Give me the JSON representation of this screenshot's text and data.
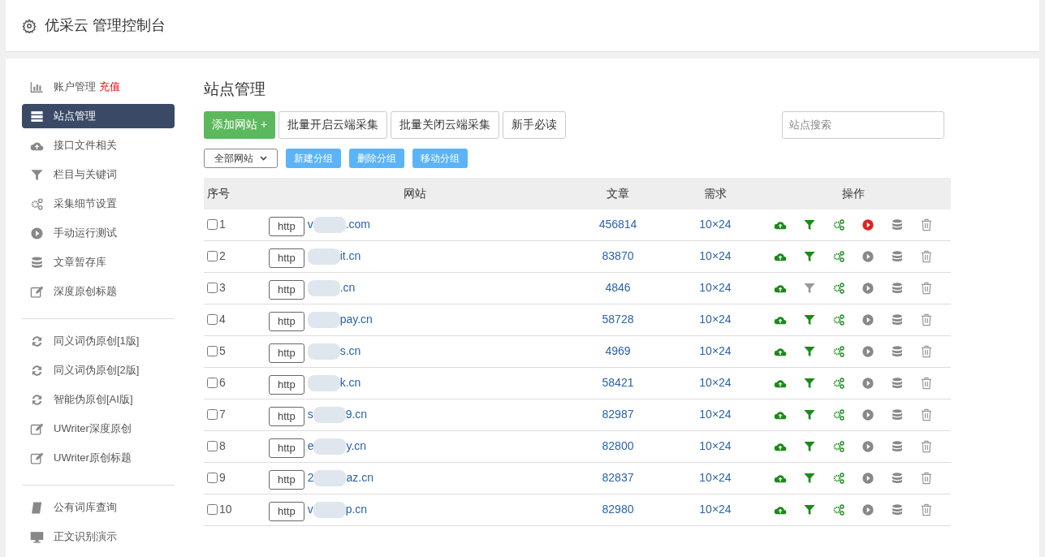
{
  "header": {
    "title": "优采云 管理控制台"
  },
  "sidebar": {
    "groups": [
      [
        {
          "label": "账户管理",
          "badge": "充值",
          "kind": "chart",
          "selected": false
        },
        {
          "label": "站点管理",
          "kind": "list",
          "selected": true
        },
        {
          "label": "接口文件相关",
          "kind": "cloud",
          "selected": false
        },
        {
          "label": "栏目与关键词",
          "kind": "filter",
          "selected": false
        },
        {
          "label": "采集细节设置",
          "kind": "gears",
          "selected": false
        },
        {
          "label": "手动运行测试",
          "kind": "play",
          "selected": false
        },
        {
          "label": "文章暂存库",
          "kind": "db",
          "selected": false
        },
        {
          "label": "深度原创标题",
          "kind": "edit",
          "selected": false
        }
      ],
      [
        {
          "label": "同义词伪原创[1版]",
          "kind": "refresh",
          "selected": false
        },
        {
          "label": "同义词伪原创[2版]",
          "kind": "refresh",
          "selected": false
        },
        {
          "label": "智能伪原创[AI版]",
          "kind": "refresh",
          "selected": false
        },
        {
          "label": "UWriter深度原创",
          "kind": "edit",
          "selected": false
        },
        {
          "label": "UWriter原创标题",
          "kind": "edit",
          "selected": false
        }
      ],
      [
        {
          "label": "公有词库查询",
          "kind": "book",
          "selected": false
        },
        {
          "label": "正文识别演示",
          "kind": "monitor",
          "selected": false
        }
      ]
    ]
  },
  "main": {
    "title": "站点管理",
    "add_button": "添加网站 +",
    "buttons": [
      "批量开启云端采集",
      "批量关闭云端采集",
      "新手必读"
    ],
    "search": {
      "placeholder": "站点搜索"
    },
    "group_select": "全部网站",
    "group_buttons": [
      "新建分组",
      "删除分组",
      "移动分组"
    ],
    "table": {
      "columns": [
        "序号",
        "网站",
        "文章",
        "需求",
        "操作"
      ],
      "rows": [
        {
          "no": "1",
          "checked": false,
          "scheme": "http",
          "prefix": "v",
          "suffix": ".com",
          "articles": "456814",
          "demand": "10×24",
          "filter_on": true,
          "running": true
        },
        {
          "no": "2",
          "checked": false,
          "scheme": "http",
          "suffix": "it.cn",
          "articles": "83870",
          "demand": "10×24",
          "filter_on": true,
          "running": false
        },
        {
          "no": "3",
          "checked": false,
          "scheme": "http",
          "suffix": ".cn",
          "articles": "4846",
          "demand": "10×24",
          "filter_on": false,
          "running": false
        },
        {
          "no": "4",
          "checked": false,
          "scheme": "http",
          "suffix": "pay.cn",
          "articles": "58728",
          "demand": "10×24",
          "filter_on": true,
          "running": false
        },
        {
          "no": "5",
          "checked": false,
          "scheme": "http",
          "suffix": "s.cn",
          "articles": "4969",
          "demand": "10×24",
          "filter_on": true,
          "running": false
        },
        {
          "no": "6",
          "checked": false,
          "scheme": "http",
          "suffix": "k.cn",
          "articles": "58421",
          "demand": "10×24",
          "filter_on": true,
          "running": false
        },
        {
          "no": "7",
          "checked": false,
          "scheme": "http",
          "prefix": "s",
          "suffix": "9.cn",
          "articles": "82987",
          "demand": "10×24",
          "filter_on": true,
          "running": false
        },
        {
          "no": "8",
          "checked": false,
          "scheme": "http",
          "prefix": "e",
          "suffix": "y.cn",
          "articles": "82800",
          "demand": "10×24",
          "filter_on": true,
          "running": false
        },
        {
          "no": "9",
          "checked": false,
          "scheme": "http",
          "prefix": "2",
          "suffix": "az.cn",
          "articles": "82837",
          "demand": "10×24",
          "filter_on": true,
          "running": false
        },
        {
          "no": "10",
          "checked": false,
          "scheme": "http",
          "prefix": "v",
          "suffix": "p.cn",
          "articles": "82980",
          "demand": "10×24",
          "filter_on": true,
          "running": false
        }
      ]
    }
  }
}
